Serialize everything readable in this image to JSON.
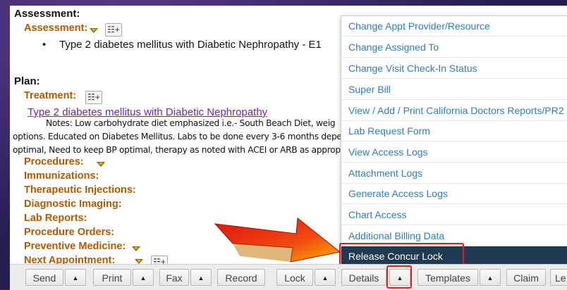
{
  "doc": {
    "assessment_heading": "Assessment:",
    "assessment_label": "Assessment:",
    "diagnosis_bullet": "•",
    "diagnosis_text": "Type 2 diabetes mellitus with Diabetic Nephropathy - E1",
    "plan_heading": "Plan:",
    "treatment_label": "Treatment:",
    "treatment_link": "Type 2 diabetes mellitus with Diabetic Nephropathy",
    "notes_line1": "Notes: Low carbohydrate diet emphasized i.e.- South Beach Diet, weig",
    "notes_line2": "options. Educated on Diabetes Mellitus. Labs to be done every 3-6 months depe",
    "notes_line3": "optimal, Need to keep BP optimal, therapy as noted with ACEI or ARB as approp",
    "sections": [
      "Procedures:",
      "Immunizations:",
      "Therapeutic Injections:",
      "Diagnostic Imaging:",
      "Lab Reports:",
      "Procedure Orders:",
      "Preventive Medicine:",
      "Next Appointment:"
    ],
    "add_icon": "add-list-icon"
  },
  "menu": {
    "items": [
      "Change Appt Provider/Resource",
      "Change Assigned To",
      "Change Visit Check-In Status",
      "Super Bill",
      "View / Add / Print California Doctors Reports/PR2",
      "Lab Request Form",
      "View Access Logs",
      "Attachment Logs",
      "Generate Access Logs",
      "Chart Access",
      "Additional Billing Data",
      "Release Concur Lock"
    ],
    "active_index": 11
  },
  "toolbar": {
    "send": "Send",
    "print": "Print",
    "fax": "Fax",
    "record": "Record",
    "lock": "Lock",
    "details": "Details",
    "templates": "Templates",
    "claim": "Claim",
    "last": "Le",
    "up_glyph": "▲"
  },
  "colors": {
    "highlight_red": "#e0201e",
    "menu_text": "#2f7fb5",
    "menu_active_bg": "#1f3a52",
    "section_orange": "#b35a00"
  }
}
